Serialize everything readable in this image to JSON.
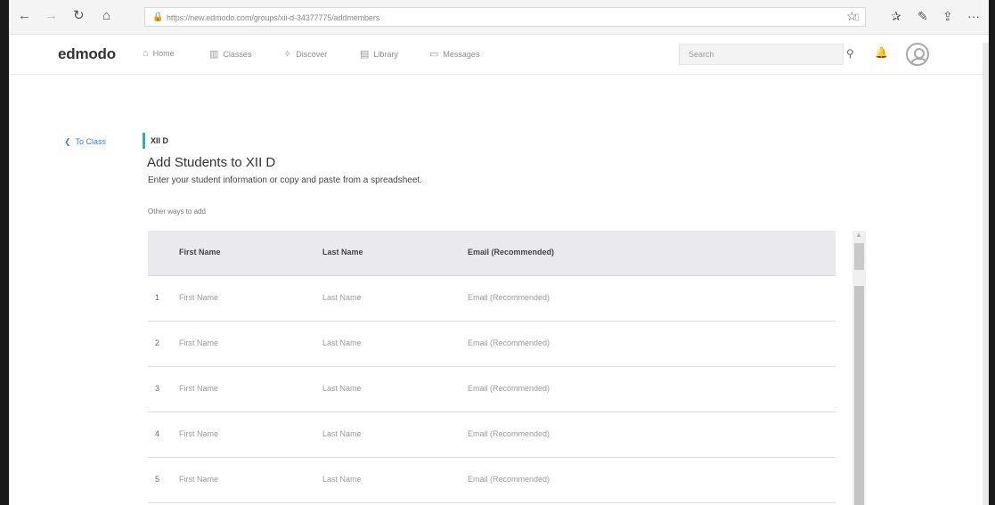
{
  "browser": {
    "url": "https://new.edmodo.com/groups/xii-d-34377775/addmembers",
    "back_glyph": "←",
    "forward_glyph": "→",
    "refresh_glyph": "↻",
    "home_glyph": "⌂",
    "lock_glyph": "🔒",
    "reader_glyph": "▯",
    "favorite_glyph": "☆",
    "favorites_glyph": "✰",
    "notes_glyph": "✎",
    "share_glyph": "⇪",
    "more_glyph": "···"
  },
  "header": {
    "logo": "edmodo",
    "nav": [
      {
        "label": "Home",
        "icon": "home-icon",
        "glyph": "⌂"
      },
      {
        "label": "Classes",
        "icon": "classes-icon",
        "glyph": "▥"
      },
      {
        "label": "Discover",
        "icon": "discover-icon",
        "glyph": "✧"
      },
      {
        "label": "Library",
        "icon": "library-icon",
        "glyph": "▤"
      },
      {
        "label": "Messages",
        "icon": "messages-icon",
        "glyph": "▭"
      }
    ],
    "search_placeholder": "Search",
    "search_glyph": "⚲",
    "bell_glyph": "🔔"
  },
  "content": {
    "back_label": "To Class",
    "back_glyph": "❮",
    "class_name": "XII D",
    "title": "Add Students to XII D",
    "subtitle": "Enter your student information or copy and paste from a spreadsheet.",
    "other_ways": "Other ways to add"
  },
  "table": {
    "headers": [
      "First Name",
      "Last Name",
      "Email (Recommended)"
    ],
    "rows": [
      {
        "num": "1",
        "first": "First Name",
        "last": "Last Name",
        "email": "Email (Recommended)"
      },
      {
        "num": "2",
        "first": "First Name",
        "last": "Last Name",
        "email": "Email (Recommended)"
      },
      {
        "num": "3",
        "first": "First Name",
        "last": "Last Name",
        "email": "Email (Recommended)"
      },
      {
        "num": "4",
        "first": "First Name",
        "last": "Last Name",
        "email": "Email (Recommended)"
      },
      {
        "num": "5",
        "first": "First Name",
        "last": "Last Name",
        "email": "Email (Recommended)"
      }
    ]
  },
  "colors": {
    "accent": "#2db39a",
    "link": "#3a82c7"
  }
}
